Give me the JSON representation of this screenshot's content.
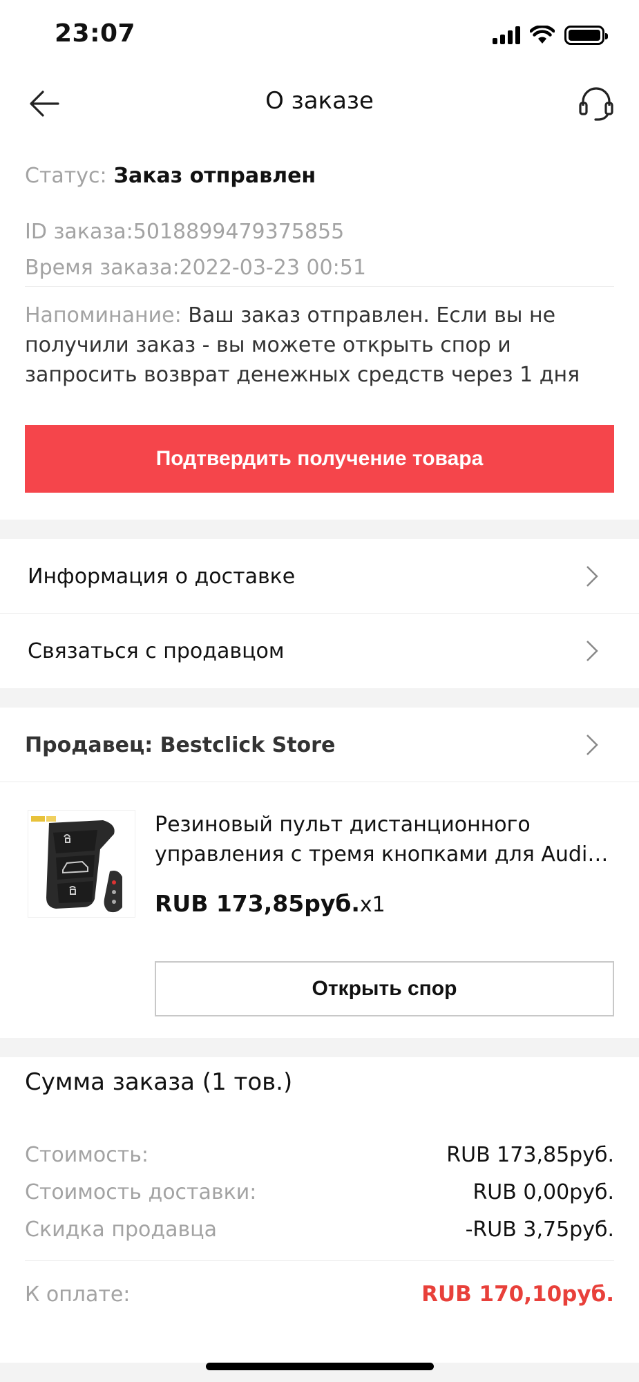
{
  "status_bar": {
    "time": "23:07"
  },
  "nav": {
    "title": "О заказе",
    "back_icon": "arrow-left-icon",
    "support_icon": "headset-icon"
  },
  "order": {
    "status_label": "Статус:",
    "status_value": "Заказ отправлен",
    "id_text": "ID заказа:5018899479375855",
    "time_text": "Время заказа:2022-03-23 00:51",
    "reminder_label": "Напоминание:",
    "reminder_text": "Ваш заказ отправлен. Если вы не получили заказ - вы можете открыть спор и запросить возврат денежных средств через 1 дня",
    "confirm_button": "Подтвердить получение товара"
  },
  "menu": {
    "delivery_info": "Информация о доставке",
    "contact_seller": "Связаться с продавцом"
  },
  "seller": {
    "label": "Продавец: Bestclick Store"
  },
  "product": {
    "title_line1": "Резиновый пульт дистанционного",
    "title_line2": "управления с тремя кнопками для Audi A...",
    "price": "RUB 173,85руб.",
    "qty": "x1",
    "dispute_button": "Открыть спор"
  },
  "summary": {
    "title": "Сумма заказа (1 тов.)",
    "rows": [
      {
        "label": "Стоимость:",
        "value": "RUB 173,85руб."
      },
      {
        "label": "Стоимость доставки:",
        "value": "RUB 0,00руб."
      },
      {
        "label": "Скидка продавца",
        "value": "-RUB 3,75руб."
      }
    ],
    "total_label": "К оплате:",
    "total_value": "RUB 170,10руб."
  },
  "colors": {
    "accent": "#f5454b",
    "total": "#e8403a",
    "muted": "#a3a3a3",
    "separator": "#f3f3f3"
  }
}
